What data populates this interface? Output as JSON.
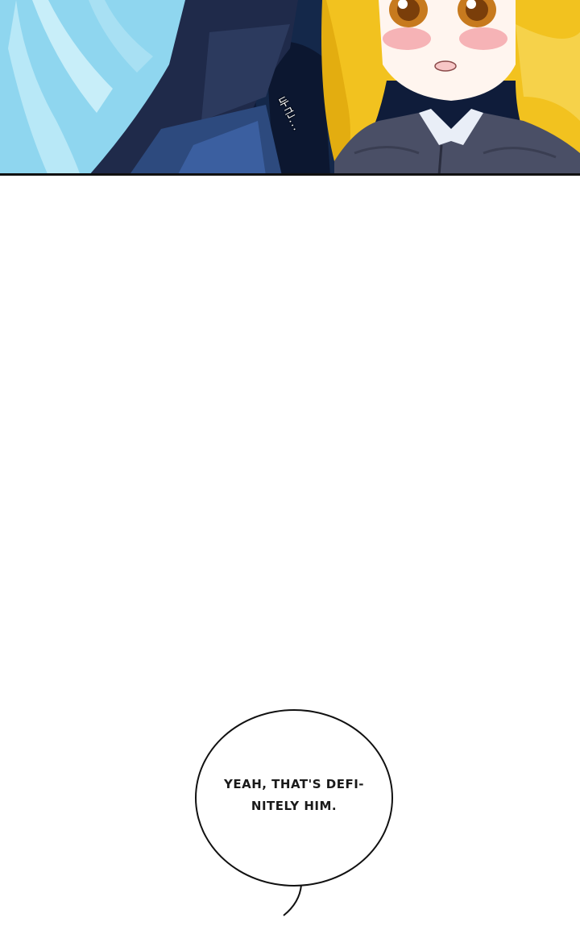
{
  "panel": {
    "sfx_text": "두근...",
    "colors": {
      "night": "#0f1c3a",
      "hair_blue": "#8fd6ef",
      "hair_blonde": "#f2c21f",
      "blush": "#f4a3a8",
      "coat": "#4a4f66"
    }
  },
  "bubble": {
    "text": "YEAH, THAT'S DEFI-NITELY HIM."
  }
}
